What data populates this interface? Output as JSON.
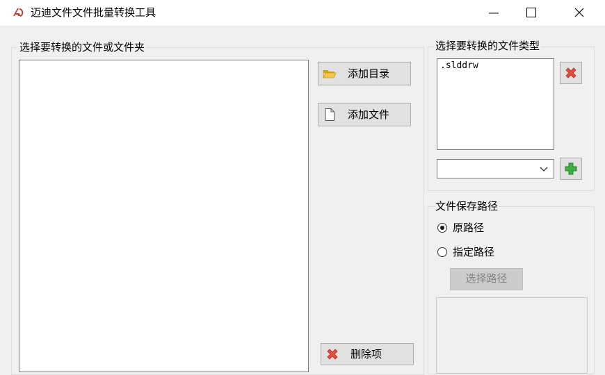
{
  "window": {
    "title": "迈迪文件文件批量转换工具",
    "accent": "#c0392b"
  },
  "file_panel": {
    "label": "选择要转换的文件或文件夹",
    "items": []
  },
  "actions": {
    "add_directory": "添加目录",
    "add_file": "添加文件",
    "delete_item": "删除项"
  },
  "file_types": {
    "label": "选择要转换的文件类型",
    "items": [
      ".slddrw"
    ],
    "combo_value": ""
  },
  "save_path": {
    "label": "文件保存路径",
    "option_original": "原路径",
    "option_specified": "指定路径",
    "selected": "原路径",
    "choose_button": "选择路径"
  },
  "icons": {
    "app": "app-logo-icon",
    "folder": "folder-open-icon",
    "file": "file-icon",
    "delete": "red-x-icon",
    "add": "green-plus-icon"
  }
}
